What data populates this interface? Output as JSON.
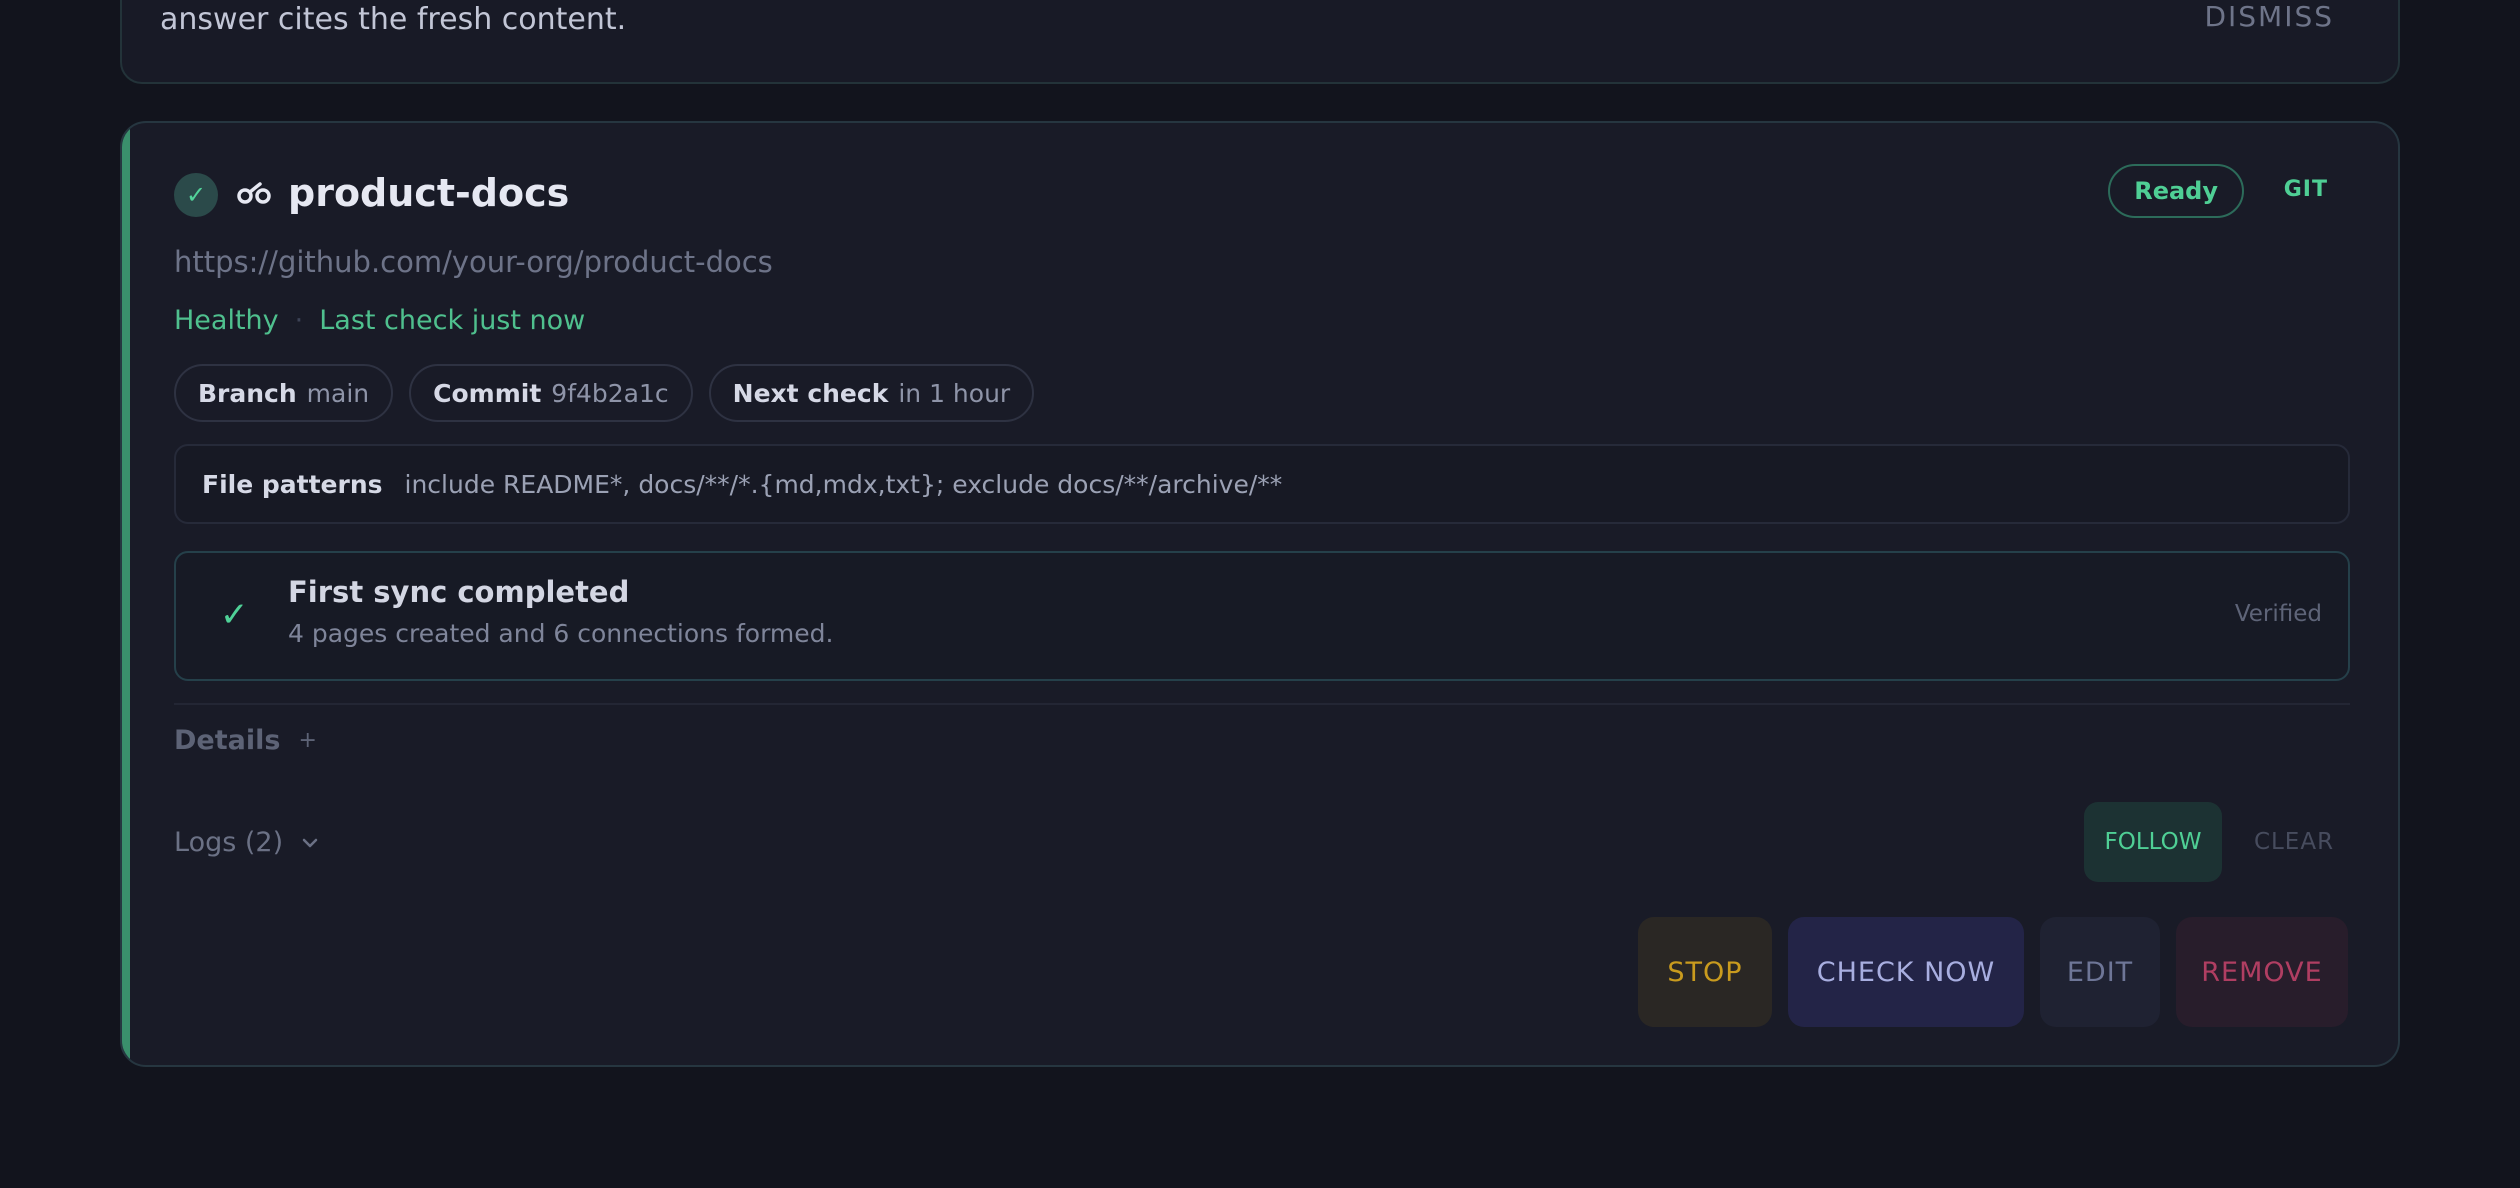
{
  "notice": {
    "text": "answer cites the fresh content.",
    "dismiss_label": "DISMISS"
  },
  "source": {
    "status_icon": "check-icon",
    "repo_icon": "git-repo-icon",
    "name": "product-docs",
    "status_badge": "Ready",
    "type_label": "GIT",
    "url": "https://github.com/your-org/product-docs",
    "health": "Healthy",
    "last_check": "Last check just now",
    "chips": [
      {
        "key": "Branch",
        "value": "main"
      },
      {
        "key": "Commit",
        "value": "9f4b2a1c"
      },
      {
        "key": "Next check",
        "value": "in 1 hour"
      }
    ],
    "file_patterns": {
      "label": "File patterns",
      "value": "include README*, docs/**/*.{md,mdx,txt}; exclude docs/**/archive/**"
    },
    "sync": {
      "title": "First sync completed",
      "subtitle": "4 pages created and 6 connections formed.",
      "state": "Verified"
    },
    "details_label": "Details",
    "details_toggle": "+",
    "logs_label": "Logs (2)",
    "follow_label": "FOLLOW",
    "clear_label": "CLEAR",
    "actions": {
      "stop": "STOP",
      "check_now": "CHECK NOW",
      "edit": "EDIT",
      "remove": "REMOVE"
    }
  },
  "colors": {
    "accent_green": "#4fcf95",
    "background": "#12141d",
    "card": "#191b27",
    "stop": "#c99b1e",
    "remove": "#b03e62"
  }
}
